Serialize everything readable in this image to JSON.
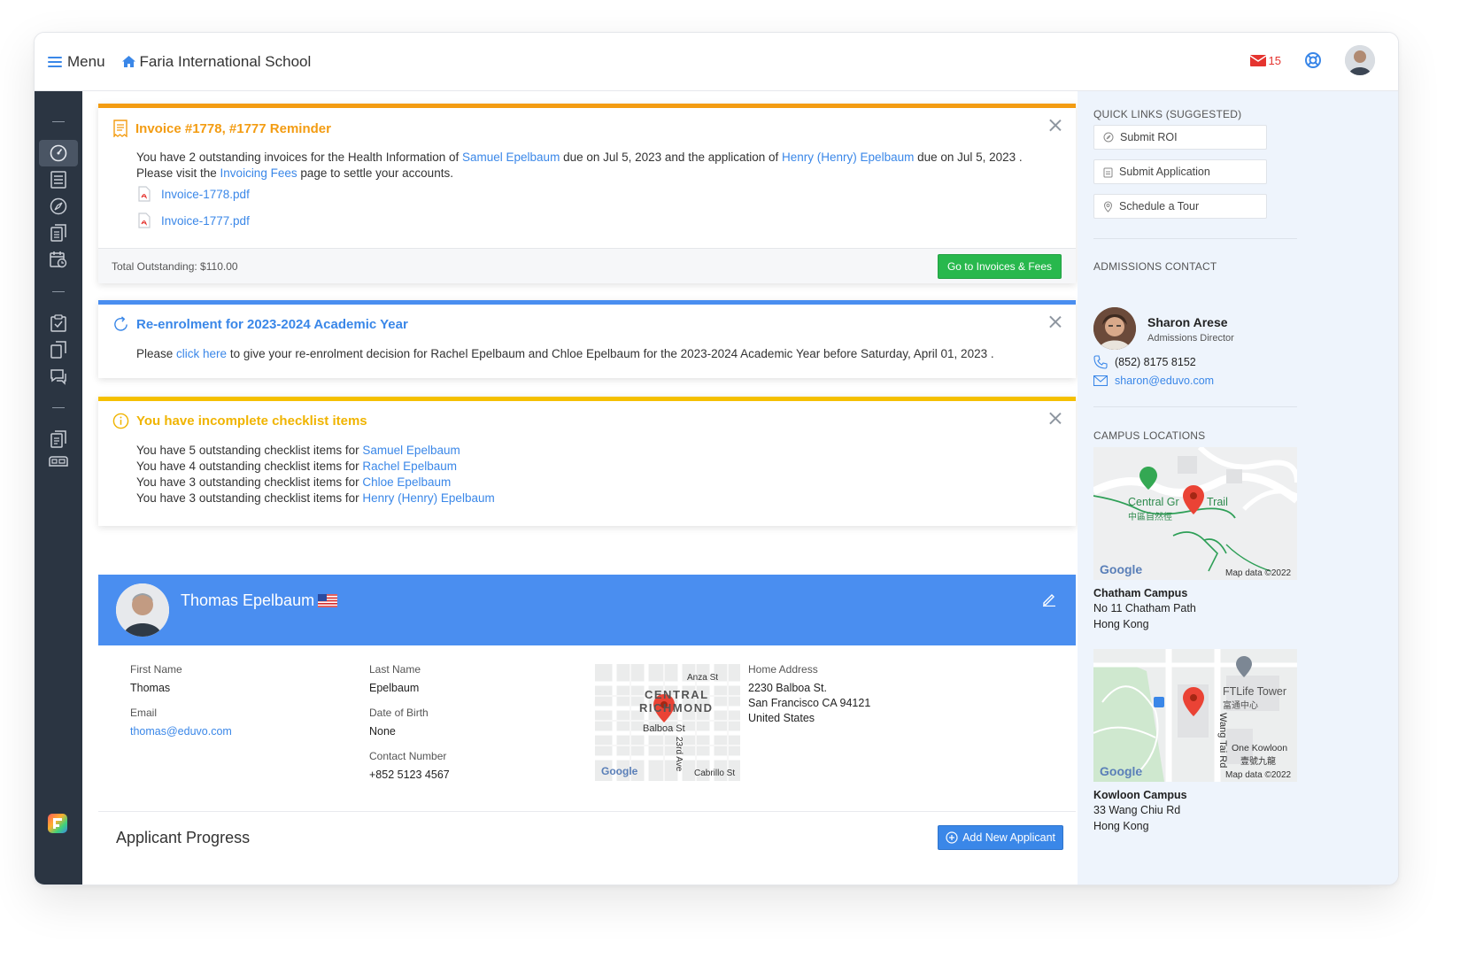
{
  "header": {
    "menu_label": "Menu",
    "school_name": "Faria International School",
    "mail_count": "15"
  },
  "invoice_card": {
    "title": "Invoice #1778, #1777 Reminder",
    "line1_prefix": "You have 2 outstanding invoices for the Health Information of ",
    "line1_link1": "Samuel Epelbaum",
    "line1_mid": " due on Jul 5, 2023 and the application of ",
    "line1_link2": "Henry (Henry) Epelbaum",
    "line1_suffix": " due on Jul 5, 2023 .",
    "line2_prefix": "Please visit the ",
    "line2_link": "Invoicing Fees",
    "line2_suffix": " page to settle your accounts.",
    "files": [
      "Invoice-1778.pdf",
      "Invoice-1777.pdf"
    ],
    "total": "Total Outstanding: $110.00",
    "button": "Go to Invoices & Fees",
    "accent": "#f39c12"
  },
  "reenrol_card": {
    "title": "Re-enrolment for 2023-2024 Academic Year",
    "text_prefix": "Please ",
    "text_link": "click here",
    "text_suffix": " to give your re-enrolment decision for Rachel Epelbaum and Chloe Epelbaum for the 2023-2024 Academic Year before Saturday, April 01, 2023 .",
    "accent": "#4a8ef0"
  },
  "checklist_card": {
    "title": "You have incomplete checklist items",
    "items": [
      {
        "prefix": "You have 5 outstanding checklist items for ",
        "name": "Samuel Epelbaum"
      },
      {
        "prefix": "You have 4 outstanding checklist items for ",
        "name": "Rachel Epelbaum"
      },
      {
        "prefix": "You have 3 outstanding checklist items for ",
        "name": "Chloe Epelbaum"
      },
      {
        "prefix": "You have 3 outstanding checklist items for ",
        "name": "Henry (Henry) Epelbaum"
      }
    ],
    "accent": "#f5c000"
  },
  "profile": {
    "name": "Thomas Epelbaum",
    "first_name_label": "First Name",
    "first_name": "Thomas",
    "last_name_label": "Last Name",
    "last_name": "Epelbaum",
    "email_label": "Email",
    "email": "thomas@eduvo.com",
    "dob_label": "Date of Birth",
    "dob": "None",
    "contact_label": "Contact Number",
    "contact": "+852 5123 4567",
    "address_label": "Home Address",
    "address_lines": [
      "2230 Balboa St.",
      "San Francisco CA 94121",
      "United States"
    ],
    "map_labels": {
      "anza": "Anza St",
      "central": "CENTRAL",
      "richmond": "RICHMOND",
      "balboa": "Balboa St",
      "ave": "23rd Ave",
      "cabrillo": "Cabrillo St",
      "google": "Google"
    }
  },
  "applicant_progress": {
    "title": "Applicant Progress",
    "button": "Add New Applicant"
  },
  "quick_links": {
    "heading": "QUICK LINKS (SUGGESTED)",
    "items": [
      "Submit ROI",
      "Submit Application",
      "Schedule a Tour"
    ]
  },
  "admissions": {
    "heading": "ADMISSIONS CONTACT",
    "name": "Sharon Arese",
    "role": "Admissions Director",
    "phone": "(852) 8175 8152",
    "email": "sharon@eduvo.com"
  },
  "campus": {
    "heading": "CAMPUS LOCATIONS",
    "locations": [
      {
        "name": "Chatham Campus",
        "line1": "No 11 Chatham Path",
        "line2": "Hong Kong",
        "map_trail": "Central Gr",
        "map_trail2": "Trail",
        "map_cn": "中區自然徑",
        "map_google": "Google",
        "map_data": "Map data ©2022"
      },
      {
        "name": "Kowloon Campus",
        "line1": "33 Wang Chiu Rd",
        "line2": "Hong Kong",
        "map_tower": "FTLife Tower",
        "map_tower_cn": "富通中心",
        "map_road": "Wang Tai Rd",
        "map_ok": "One Kowloon",
        "map_ok_cn": "壹號九龍",
        "map_google": "Google",
        "map_data": "Map data ©2022"
      }
    ]
  }
}
